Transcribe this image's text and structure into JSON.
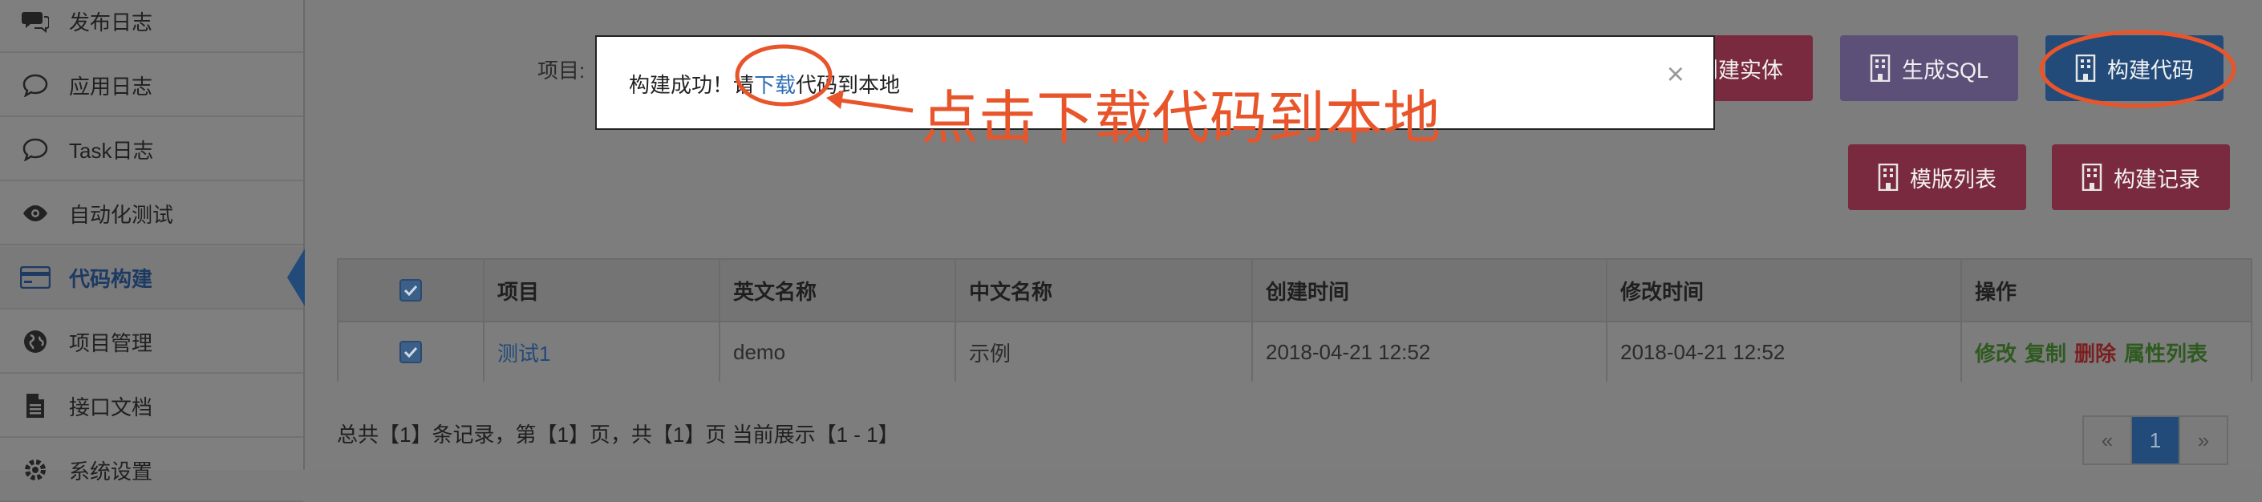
{
  "sidebar": {
    "items": [
      {
        "label": "发布日志",
        "icon": "chat-bubbles-icon"
      },
      {
        "label": "应用日志",
        "icon": "chat-bubble-icon"
      },
      {
        "label": "Task日志",
        "icon": "chat-bubble-icon"
      },
      {
        "label": "自动化测试",
        "icon": "eye-icon"
      },
      {
        "label": "代码构建",
        "icon": "credit-card-icon",
        "active": true
      },
      {
        "label": "项目管理",
        "icon": "globe-icon"
      },
      {
        "label": "接口文档",
        "icon": "document-icon"
      },
      {
        "label": "系统设置",
        "icon": "gear-icon"
      }
    ]
  },
  "filter": {
    "label": "项目:"
  },
  "toolbar": {
    "build_entity": "创建实体",
    "generate_sql": "生成SQL",
    "build_code": "构建代码",
    "template_list": "模版列表",
    "build_log": "构建记录"
  },
  "table": {
    "headers": [
      "项目",
      "英文名称",
      "中文名称",
      "创建时间",
      "修改时间",
      "操作"
    ],
    "rows": [
      {
        "project": "测试1",
        "en_name": "demo",
        "cn_name": "示例",
        "created": "2018-04-21 12:52",
        "modified": "2018-04-21 12:52",
        "actions": [
          "修改",
          "复制",
          "删除",
          "属性列表"
        ]
      }
    ]
  },
  "summary": "总共【1】条记录，第【1】页，共【1】页 当前展示【1 - 1】",
  "pagination": {
    "prev": "«",
    "current": "1",
    "next": "»"
  },
  "modal": {
    "prefix": "构建成功！请",
    "link": "下载",
    "suffix": "代码到本地",
    "close": "×"
  },
  "annotation": {
    "text": "点击下载代码到本地"
  },
  "colors": {
    "active": "#234b7a",
    "danger": "#7a2a3f",
    "purple": "#5c4f78",
    "annotation": "#e8552a",
    "link": "#2e6cb5"
  }
}
